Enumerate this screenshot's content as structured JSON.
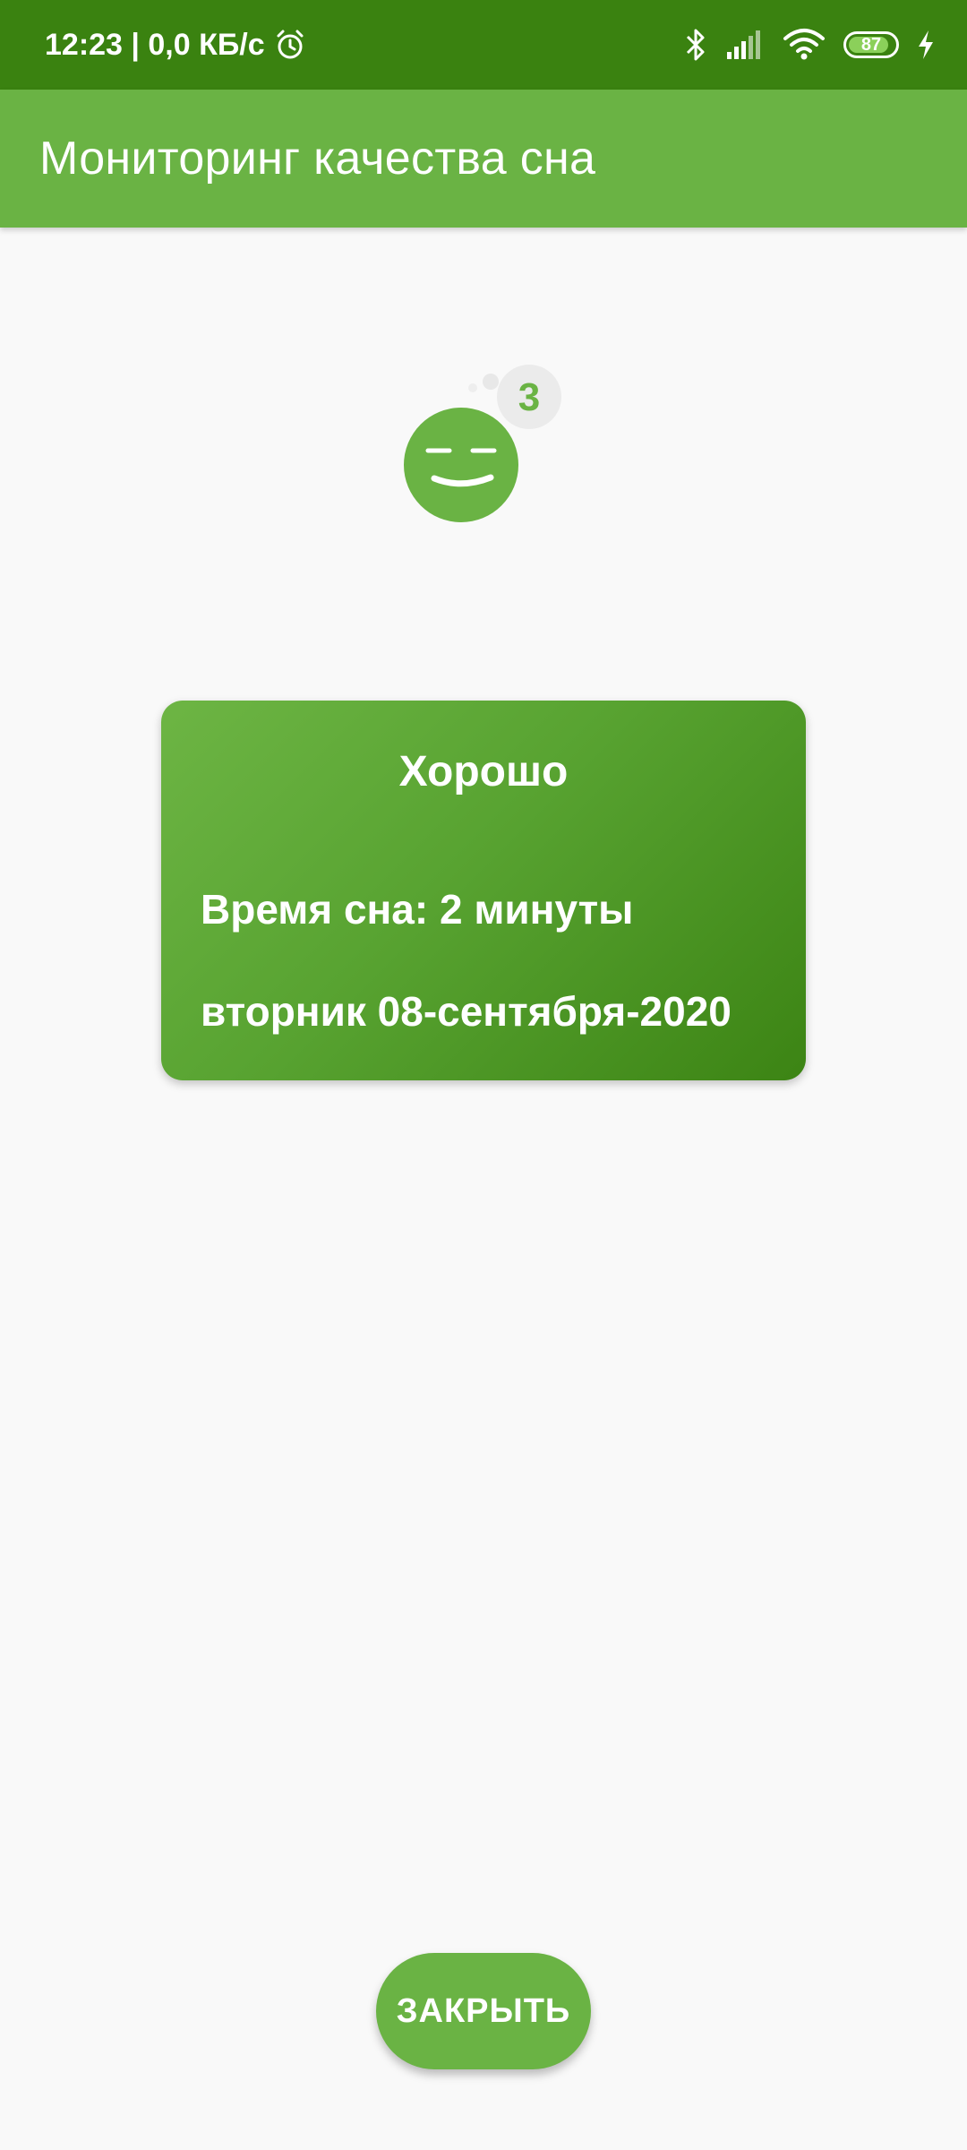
{
  "status_bar": {
    "time_speed": "12:23 | 0,0 КБ/с",
    "battery_level": "87",
    "battery_fraction": 0.87,
    "icons": [
      "alarm-icon",
      "bluetooth-icon",
      "signal-icon",
      "wifi-icon",
      "battery-icon",
      "charging-icon"
    ]
  },
  "app_bar": {
    "title": "Мониторинг качества сна"
  },
  "sleep_score": {
    "value": "3",
    "icon": "sleeping-face-icon"
  },
  "result_card": {
    "rating": "Хорошо",
    "duration": "Время сна: 2 минуты",
    "date": "вторник 08-сентября-2020"
  },
  "close_button": {
    "label": "ЗАКРЫТЬ"
  },
  "colors": {
    "status_bar": "#3a8210",
    "app_bar": "#6ab344",
    "accent": "#6ab344",
    "background": "#f9f9f9"
  }
}
